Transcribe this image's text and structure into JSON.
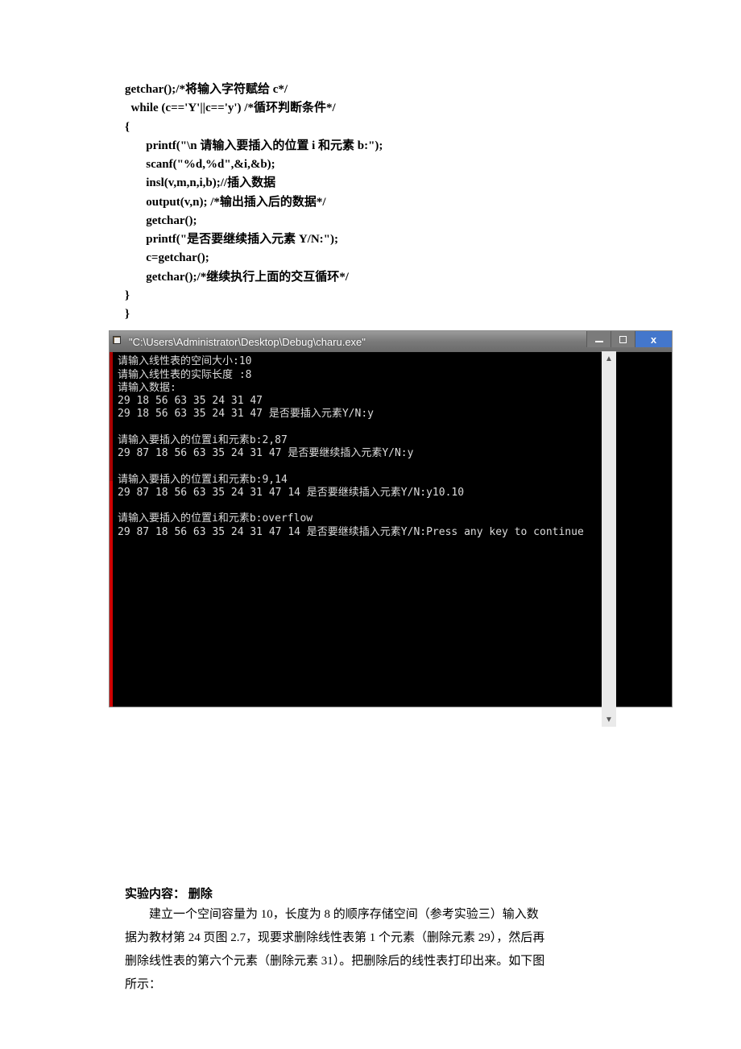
{
  "code": {
    "l1": "getchar();/*将输入字符赋给 c*/",
    "l2": "  while (c=='Y'||c=='y') /*循环判断条件*/",
    "l3": "{",
    "l4": "       printf(\"\\n 请输入要插入的位置 i 和元素 b:\");",
    "l5": "       scanf(\"%d,%d\",&i,&b);",
    "l6": "       insl(v,m,n,i,b);//插入数据",
    "l7": "       output(v,n); /*输出插入后的数据*/",
    "l8": "       getchar();",
    "l9": "       printf(\"是否要继续插入元素 Y/N:\");",
    "l10": "       c=getchar();",
    "l11": "       getchar();/*继续执行上面的交互循环*/",
    "l12": "}",
    "l13": "}"
  },
  "console": {
    "title": "\"C:\\Users\\Administrator\\Desktop\\Debug\\charu.exe\"",
    "lines": {
      "a": "请输入线性表的空间大小:10",
      "b": "请输入线性表的实际长度 :8",
      "c": "请输入数据:",
      "d": "29 18 56 63 35 24 31 47",
      "e": "29 18 56 63 35 24 31 47 是否要插入元素Y/N:y",
      "blank1": "",
      "f": "请输入要插入的位置i和元素b:2,87",
      "g": "29 87 18 56 63 35 24 31 47 是否要继续插入元素Y/N:y",
      "blank2": "",
      "h": "请输入要插入的位置i和元素b:9,14",
      "i": "29 87 18 56 63 35 24 31 47 14 是否要继续插入元素Y/N:y10.10",
      "blank3": "",
      "j": "请输入要插入的位置i和元素b:overflow",
      "k": "29 87 18 56 63 35 24 31 47 14 是否要继续插入元素Y/N:Press any key to continue"
    }
  },
  "section": {
    "title": "实验内容： 删除",
    "body1": "建立一个空间容量为 10，长度为 8 的顺序存储空间（参考实验三）输入数",
    "body2": "据为教材第 24 页图 2.7，现要求删除线性表第 1 个元素（删除元素 29），然后再",
    "body3": "删除线性表的第六个元素（删除元素 31）。把删除后的线性表打印出来。如下图",
    "body4": "所示："
  }
}
